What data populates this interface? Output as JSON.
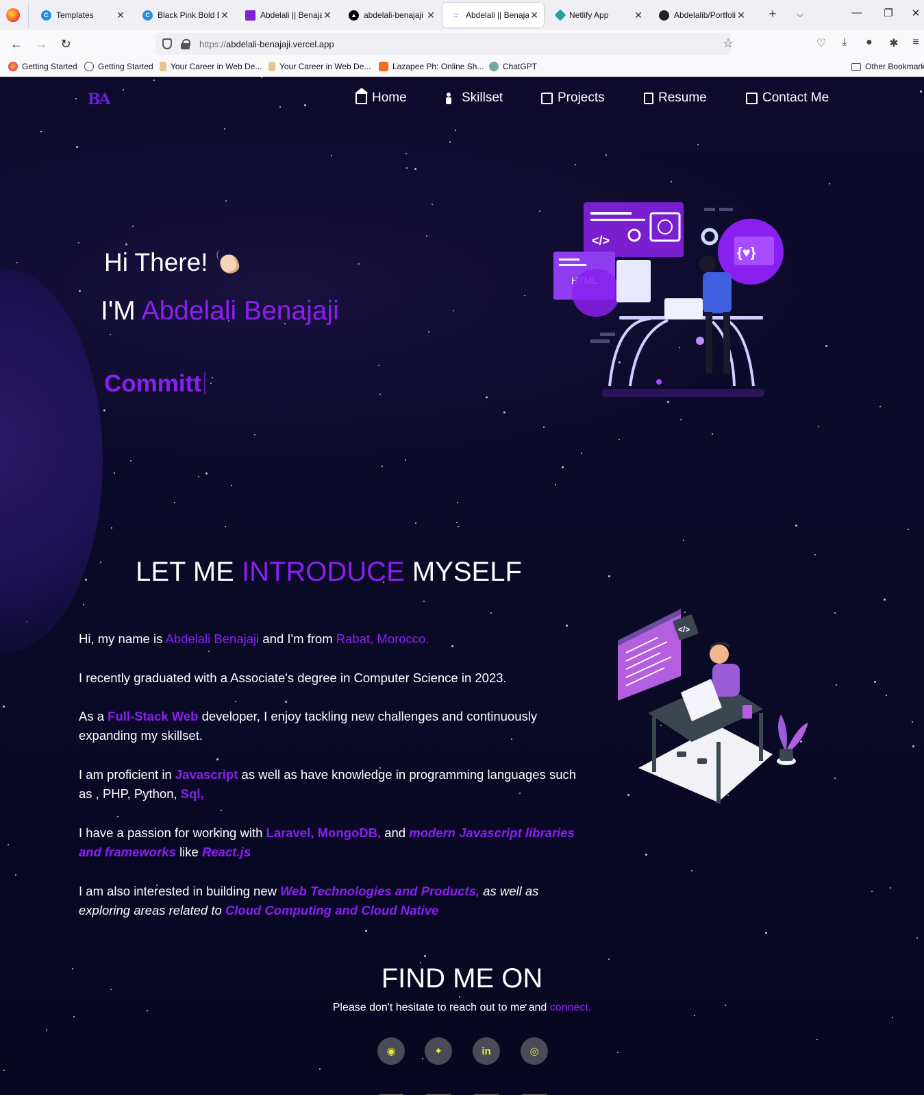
{
  "browser": {
    "tabs": [
      {
        "title": "Templates",
        "favicon": "canva-icon",
        "color": "#1f8ded"
      },
      {
        "title": "Black Pink Bold El",
        "favicon": "canva-icon",
        "color": "#1f8ded"
      },
      {
        "title": "Abdelali || Benajaji",
        "favicon": "portfolio-icon",
        "color": "#7c22d8"
      },
      {
        "title": "abdelali-benajaji -",
        "favicon": "vercel-icon",
        "color": "#000000"
      },
      {
        "title": "Abdelali || Benajaji",
        "favicon": "portfolio-icon",
        "color": "#7c22d8"
      },
      {
        "title": "Netlify App",
        "favicon": "netlify-icon",
        "color": "#20a3a0"
      },
      {
        "title": "Abdelalib/Portfoli",
        "favicon": "github-icon",
        "color": "#222222"
      }
    ],
    "active_tab_index": 4,
    "url_prefix": "https://",
    "url_host": "abdelali-benajaji.vercel.app",
    "bookmarks": [
      {
        "label": "Getting Started",
        "icon": "firefox-icon"
      },
      {
        "label": "Getting Started",
        "icon": "globe-icon"
      },
      {
        "label": "Your Career in Web De...",
        "icon": "bookmark-icon"
      },
      {
        "label": "Your Career in Web De...",
        "icon": "bookmark-icon"
      },
      {
        "label": "Lazapee Ph: Online Sh...",
        "icon": "lazapee-icon"
      },
      {
        "label": "ChatGPT",
        "icon": "chatgpt-icon"
      }
    ],
    "other_bookmarks": "Other Bookmark"
  },
  "site": {
    "logo": "BA",
    "nav": [
      {
        "label": "Home",
        "icon": "home-icon"
      },
      {
        "label": "Skillset",
        "icon": "skillset-icon"
      },
      {
        "label": "Projects",
        "icon": "projects-icon"
      },
      {
        "label": "Resume",
        "icon": "resume-icon"
      },
      {
        "label": "Contact Me",
        "icon": "contact-icon"
      }
    ],
    "accent": "#8a20f0"
  },
  "hero": {
    "greeting": "Hi There!",
    "im_prefix": "I'M ",
    "name": "Abdelali Benajaji",
    "typed_text": "Committ"
  },
  "intro": {
    "title_a": "LET ME ",
    "title_b": "INTRODUCE",
    "title_c": " MYSELF",
    "p1": {
      "a": "Hi, my name is ",
      "b": "Abdelali Benajaji",
      "c": " and I'm from ",
      "d": "Rabat, Morocco."
    },
    "p2": "I recently graduated with a Associate's degree in Computer Science in 2023.",
    "p3": {
      "a": "As a ",
      "b": "Full-Stack Web",
      "c": " developer, I enjoy tackling new challenges and continuously expanding my skillset."
    },
    "p4": {
      "a": "I am proficient in ",
      "b": "Javascript",
      "c": " as well as have knowledge in programming languages such as , PHP, Python, ",
      "d": "Sql,"
    },
    "p5": {
      "a": "I have a passion for working with ",
      "b": "Laravel, MongoDB,",
      "c": " and ",
      "d": "modern Javascript libraries and frameworks",
      "e": " like ",
      "f": "React.js"
    },
    "p6": {
      "a": "I am also interested in building new ",
      "b": "Web Technologies and Products,",
      "c": " as well as exploring areas related to ",
      "d": "Cloud Computing and Cloud Native"
    }
  },
  "find": {
    "title": "FIND ME ON",
    "sub_a": "Please don't hesitate to reach out to me and ",
    "sub_b": "connect.",
    "socials": [
      {
        "name": "github",
        "icon": "github-icon",
        "glyph": "◉"
      },
      {
        "name": "twitter",
        "icon": "twitter-icon",
        "glyph": "✦"
      },
      {
        "name": "linkedin",
        "icon": "linkedin-icon",
        "glyph": "in"
      },
      {
        "name": "instagram",
        "icon": "instagram-icon",
        "glyph": "◎"
      }
    ]
  }
}
